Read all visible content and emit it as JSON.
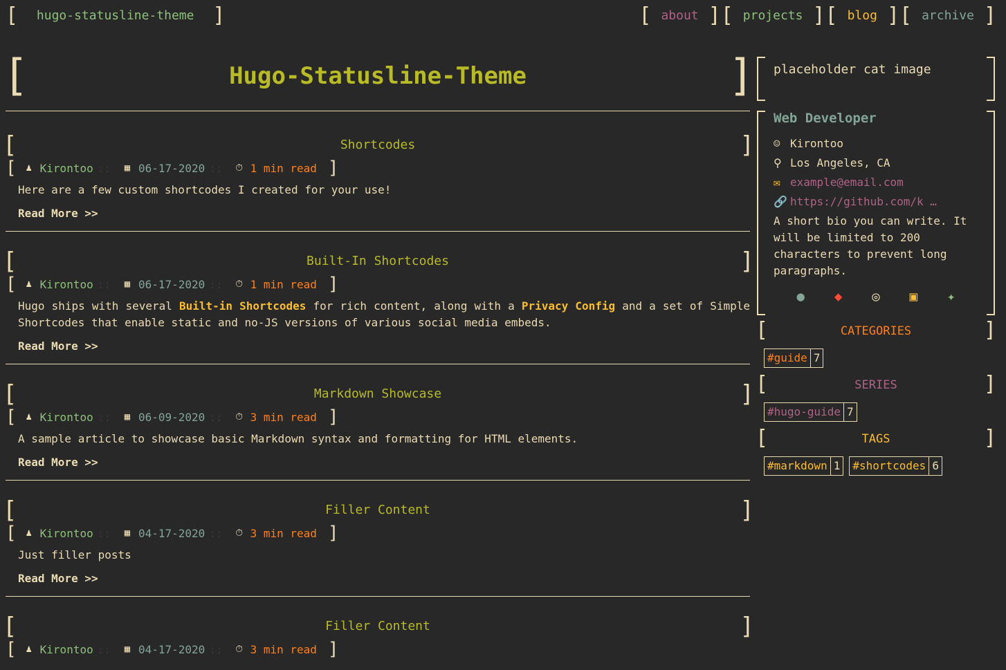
{
  "site": {
    "title": "hugo-statusline-theme"
  },
  "nav": [
    {
      "label": "about",
      "color": "#b16286"
    },
    {
      "label": "projects",
      "color": "#8ec07c"
    },
    {
      "label": "blog",
      "color": "#fabd2f"
    },
    {
      "label": "archive",
      "color": "#83a598"
    }
  ],
  "hero": {
    "title": "Hugo-Statusline-Theme"
  },
  "posts": [
    {
      "title": "Shortcodes",
      "author": "Kirontoo",
      "date": "06-17-2020",
      "read": "1 min read",
      "excerpt": "Here are a few custom shortcodes I created for your use!",
      "more": "Read More >>"
    },
    {
      "title": "Built-In Shortcodes",
      "author": "Kirontoo",
      "date": "06-17-2020",
      "read": "1 min read",
      "excerpt_parts": [
        "Hugo ships with several ",
        "Built-in Shortcodes",
        " for rich content, along with a ",
        "Privacy Config",
        " and a set of Simple Shortcodes that enable static and no-JS versions of various social media embeds."
      ],
      "more": "Read More >>"
    },
    {
      "title": "Markdown Showcase",
      "author": "Kirontoo",
      "date": "06-09-2020",
      "read": "3 min read",
      "excerpt": "A sample article to showcase basic Markdown syntax and formatting for HTML elements.",
      "more": "Read More >>"
    },
    {
      "title": "Filler Content",
      "author": "Kirontoo",
      "date": "04-17-2020",
      "read": "3 min read",
      "excerpt": "Just filler posts",
      "more": "Read More >>"
    },
    {
      "title": "Filler Content",
      "author": "Kirontoo",
      "date": "04-17-2020",
      "read": "3 min read"
    }
  ],
  "profile": {
    "avatar_alt": "placeholder cat image",
    "job": "Web Developer",
    "name": "Kirontoo",
    "location": "Los Angeles, CA",
    "email": "example@email.com",
    "website": "https://github.com/k …",
    "bio": "A short bio you can write. It will be limited to 200 characters to prevent long paragraphs.",
    "social": [
      {
        "icon": "facebook-icon",
        "glyph": "●",
        "color": "#83a598"
      },
      {
        "icon": "github-icon",
        "glyph": "◆",
        "color": "#fb4934"
      },
      {
        "icon": "instagram-icon",
        "glyph": "◎",
        "color": "#ebdbb2"
      },
      {
        "icon": "linkedin-icon",
        "glyph": "▣",
        "color": "#fabd2f"
      },
      {
        "icon": "twitter-icon",
        "glyph": "✦",
        "color": "#8ec07c"
      }
    ]
  },
  "categories": {
    "heading": "CATEGORIES",
    "color": "#fe8019",
    "items": [
      {
        "name": "#guide",
        "count": "7"
      }
    ]
  },
  "series": {
    "heading": "SERIES",
    "color": "#b16286",
    "items": [
      {
        "name": "#hugo-guide",
        "count": "7"
      }
    ]
  },
  "tags": {
    "heading": "TAGS",
    "color": "#fabd2f",
    "items": [
      {
        "name": "#markdown",
        "count": "1"
      },
      {
        "name": "#shortcodes",
        "count": "6"
      }
    ]
  }
}
